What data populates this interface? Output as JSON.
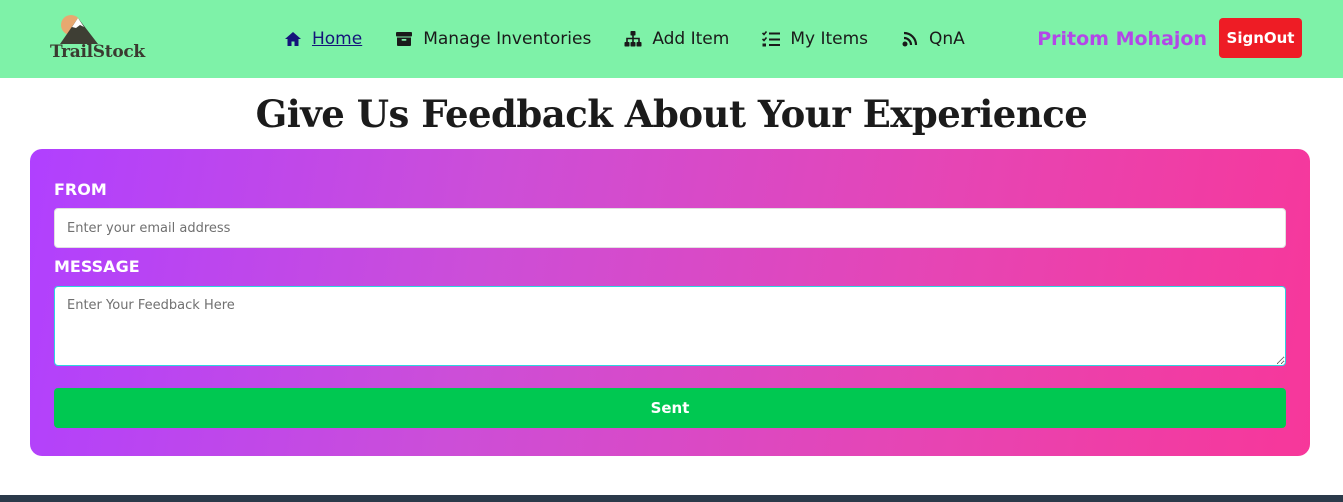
{
  "header": {
    "brand": "TrailStock",
    "nav": [
      {
        "label": "Home",
        "icon": "home-icon",
        "active": true
      },
      {
        "label": "Manage Inventories",
        "icon": "archive-icon"
      },
      {
        "label": "Add Item",
        "icon": "sitemap-icon"
      },
      {
        "label": "My Items",
        "icon": "list-check-icon"
      },
      {
        "label": "QnA",
        "icon": "broadcast-icon"
      }
    ],
    "user_name": "Pritom Mohajon",
    "signout_label": "SignOut"
  },
  "main": {
    "title": "Give Us Feedback About Your Experience",
    "form": {
      "from_label": "FROM",
      "email_placeholder": "Enter your email address",
      "email_value": "",
      "message_label": "MESSAGE",
      "message_placeholder": "Enter Your Feedback Here",
      "message_value": "",
      "submit_label": "Sent"
    }
  },
  "colors": {
    "navbar_bg": "#7ef2a8",
    "user_name": "#b347e8",
    "signout_bg": "#ee1c25",
    "card_gradient_start": "#b040ff",
    "card_gradient_end": "#f7379a",
    "submit_bg": "#00c851",
    "footer_bg": "#2b3a4a"
  }
}
